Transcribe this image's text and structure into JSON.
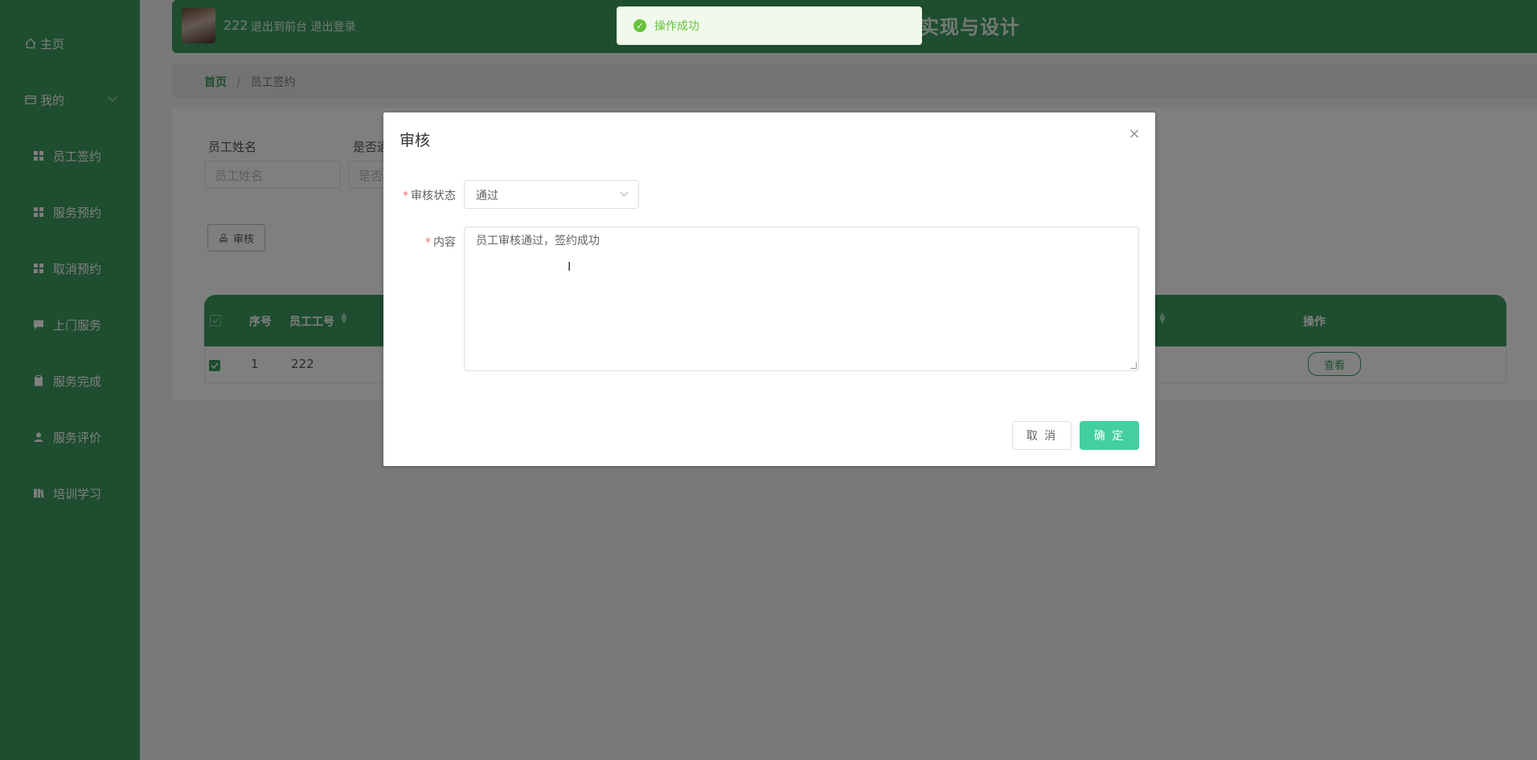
{
  "sidebar": {
    "items": [
      {
        "label": "主页",
        "icon": "home-icon"
      },
      {
        "label": "我的",
        "icon": "wallet-icon"
      },
      {
        "label": "员工签约",
        "icon": "grid-icon"
      },
      {
        "label": "服务预约",
        "icon": "grid-icon"
      },
      {
        "label": "取消预约",
        "icon": "grid-icon"
      },
      {
        "label": "上门服务",
        "icon": "chat-icon"
      },
      {
        "label": "服务完成",
        "icon": "clipboard-icon"
      },
      {
        "label": "服务评价",
        "icon": "user-icon"
      },
      {
        "label": "培训学习",
        "icon": "book-icon"
      }
    ]
  },
  "header": {
    "username": "222",
    "link_front": "退出到前台",
    "link_logout": "退出登录",
    "title_visible": "实现与设计"
  },
  "breadcrumb": {
    "home": "首页",
    "separator": "/",
    "current": "员工签约"
  },
  "search": {
    "name_label": "员工姓名",
    "name_placeholder": "员工姓名",
    "status_label": "是否通",
    "status_placeholder": "是否"
  },
  "toolbar": {
    "audit_label": "审核"
  },
  "table": {
    "headers": {
      "index": "序号",
      "employee_no": "员工工号",
      "action": "操作"
    },
    "rows": [
      {
        "index": "1",
        "employee_no": "222",
        "view_label": "查看"
      }
    ]
  },
  "toast": {
    "message": "操作成功"
  },
  "dialog": {
    "title": "审核",
    "close_symbol": "×",
    "status_label": "审核状态",
    "status_value": "通过",
    "content_label": "内容",
    "content_value": "员工审核通过，签约成功",
    "cancel_label": "取 消",
    "confirm_label": "确 定"
  },
  "colors": {
    "primary_green": "#3c9a5e",
    "confirm_button": "#44cfa0",
    "toast_success": "#67c23a",
    "required_asterisk": "#f56c6c"
  }
}
